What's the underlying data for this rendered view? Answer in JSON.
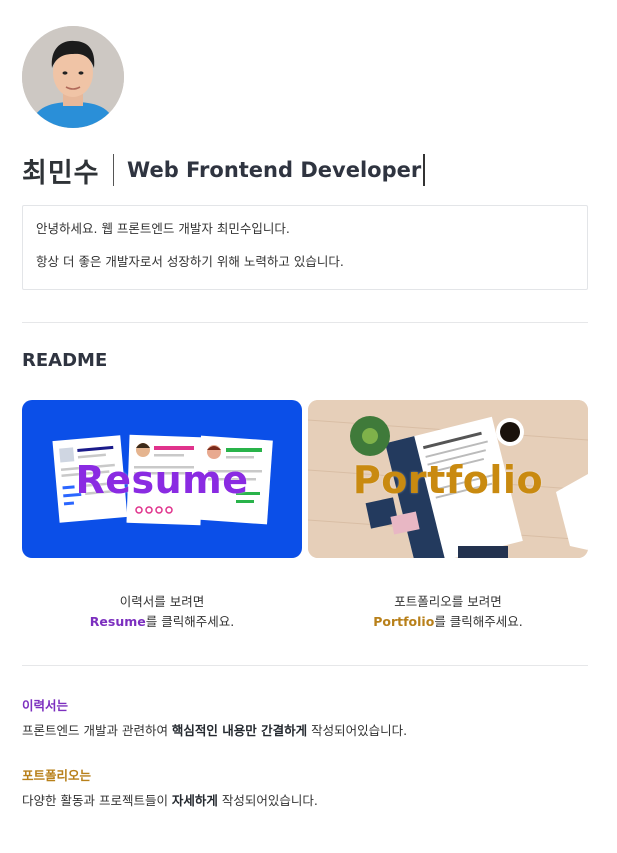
{
  "profile": {
    "name": "최민수",
    "role": "Web Frontend Developer"
  },
  "intro": {
    "line1": "안녕하세요. 웹 프론트엔드 개발자 최민수입니다.",
    "line2": "항상 더 좋은 개발자로서 성장하기 위해 노력하고 있습니다."
  },
  "readme": {
    "heading": "README",
    "cards": [
      {
        "label": "Resume",
        "caption_line1": "이력서를 보려면",
        "caption_link": "Resume",
        "caption_rest": "를 클릭해주세요."
      },
      {
        "label": "Portfolio",
        "caption_line1": "포트폴리오를 보려면",
        "caption_link": "Portfolio",
        "caption_rest": "를 클릭해주세요."
      }
    ]
  },
  "notes": {
    "resume_label": "이력서는",
    "resume_pre": "프론트엔드 개발과 관련하여 ",
    "resume_bold": "핵심적인 내용만 간결하게",
    "resume_post": " 작성되어있습니다.",
    "portfolio_label": "포트폴리오는",
    "portfolio_pre": "다양한 활동과 프로젝트들이 ",
    "portfolio_bold": "자세하게",
    "portfolio_post": " 작성되어있습니다."
  },
  "colors": {
    "resume_accent": "#7c2fbf",
    "portfolio_accent": "#b8801a",
    "resume_card_bg": "#0b4fe8"
  }
}
